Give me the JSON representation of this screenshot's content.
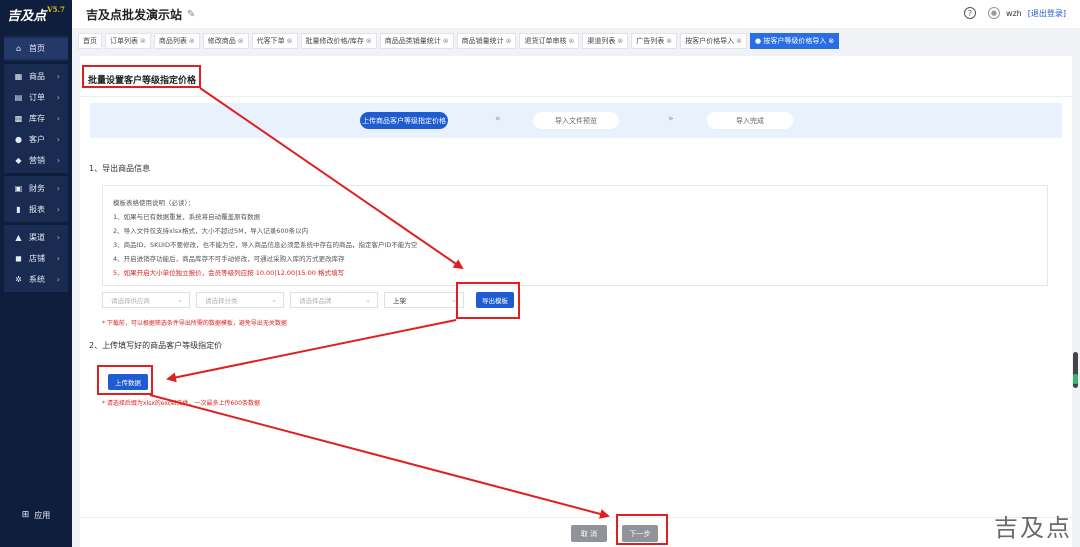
{
  "app": {
    "logo": "吉及点",
    "version": "V5.7",
    "title": "吉及点批发演示站"
  },
  "header": {
    "help": "?",
    "user": "wzh",
    "logout": "[退出登录]"
  },
  "sidebar": {
    "groups": [
      [
        {
          "label": "首页",
          "icon": "home-icon"
        }
      ],
      [
        {
          "label": "商品",
          "icon": "cart-icon"
        },
        {
          "label": "订单",
          "icon": "order-icon"
        },
        {
          "label": "库存",
          "icon": "grid-icon"
        },
        {
          "label": "客户",
          "icon": "user-icon"
        },
        {
          "label": "营销",
          "icon": "tag-icon"
        }
      ],
      [
        {
          "label": "财务",
          "icon": "wallet-icon"
        },
        {
          "label": "报表",
          "icon": "chart-icon"
        }
      ],
      [
        {
          "label": "渠道",
          "icon": "channel-icon"
        },
        {
          "label": "店铺",
          "icon": "store-icon"
        },
        {
          "label": "系统",
          "icon": "gear-icon"
        }
      ]
    ],
    "app_label": "应用"
  },
  "tabs": [
    {
      "label": "首页",
      "closable": false
    },
    {
      "label": "订单列表",
      "closable": true
    },
    {
      "label": "商品列表",
      "closable": true
    },
    {
      "label": "修改商品",
      "closable": true
    },
    {
      "label": "代客下单",
      "closable": true
    },
    {
      "label": "批量修改价格/库存",
      "closable": true
    },
    {
      "label": "商品品类销量统计",
      "closable": true
    },
    {
      "label": "商品销量统计",
      "closable": true
    },
    {
      "label": "退货订单审核",
      "closable": true
    },
    {
      "label": "渠道列表",
      "closable": true
    },
    {
      "label": "广告列表",
      "closable": true
    },
    {
      "label": "按客户价格导入",
      "closable": true
    },
    {
      "label": "● 按客户等级价格导入",
      "closable": true,
      "active": true
    }
  ],
  "page": {
    "title": "批量设置客户等级指定价格",
    "steps": [
      "上传商品客户等级指定价格",
      "导入文件预览",
      "导入完成"
    ],
    "section1": "1、导出商品信息",
    "rules": [
      "模板表格使用说明（必读）：",
      "1、如果与已有数据重复，系统将自动覆盖原有数据",
      "2、导入文件仅支持xlsx格式，大小不超过5M，导入记录600条以内",
      "3、商品ID、SKUID不要修改，也不能为空，导入商品信息必须是系统中存在的商品，指定客户ID不能为空",
      "4、开启进销存功能后，商品库存不可手动修改，可通过采购入库的方式更改库存",
      "5、如果开启大小单位独立报价，会员等级列应按 10.00|12.00|15.00 格式填写"
    ],
    "filters": {
      "category": "请选择供应商",
      "group": "请选择分类",
      "brand": "请选择品牌",
      "status": "上架"
    },
    "export_button": "导出模板",
    "export_note": "* 下载前，可以根据筛选条件导出所需的数据模板，避免导出无关数据",
    "section2": "2、上传填写好的商品客户等级指定价",
    "upload_button": "上传数据",
    "upload_note": "* 请选择后缀为xlsx的excel文件，一次最多上传600条数据",
    "cancel_button": "取 消",
    "next_button": "下一步"
  },
  "watermark": "吉及点",
  "colors": {
    "primary": "#1f5bd1",
    "annotation": "#e02020",
    "sidebar": "#0f1e3d"
  }
}
